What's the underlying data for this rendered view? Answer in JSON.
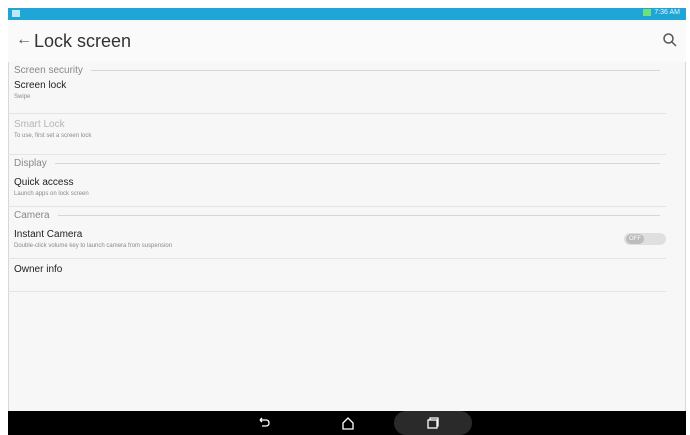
{
  "status_bar": {
    "right_text": "7:36 AM"
  },
  "header": {
    "title": "Lock screen",
    "back_icon": "arrow-left-icon",
    "search_icon": "magnifier-icon"
  },
  "sections": {
    "screen_security": {
      "label": "Screen security",
      "items": [
        {
          "title": "Screen lock",
          "subtitle": "Swipe"
        },
        {
          "title": "Smart Lock",
          "subtitle": "To use, first set a screen lock"
        }
      ]
    },
    "display": {
      "label": "Display",
      "items": [
        {
          "title": "Quick access",
          "subtitle": "Launch apps on lock screen"
        }
      ]
    },
    "camera": {
      "label": "Camera",
      "items": [
        {
          "title": "Instant Camera",
          "subtitle": "Double-click volume key to launch camera from suspension",
          "toggle_label": "OFF"
        },
        {
          "title": "Owner info",
          "subtitle": ""
        }
      ]
    }
  },
  "nav_bar": {
    "back_icon": "back-icon",
    "home_icon": "home-icon",
    "recents_icon": "recents-icon"
  }
}
